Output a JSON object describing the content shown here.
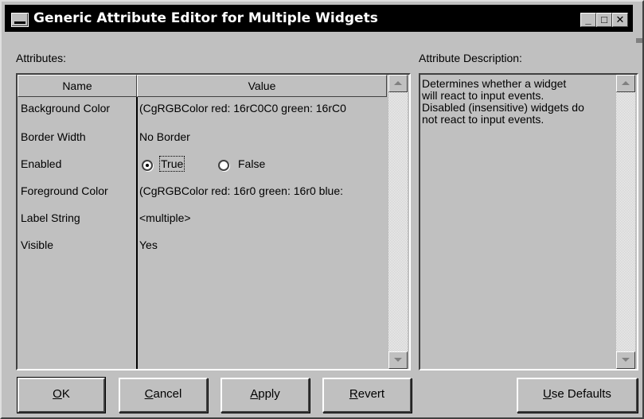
{
  "window": {
    "title": "Generic Attribute Editor for Multiple Widgets",
    "minimize_glyph": "_",
    "maximize_glyph": "□",
    "close_glyph": "✕"
  },
  "attributes_label": "Attributes:",
  "description_label": "Attribute Description:",
  "table": {
    "headers": [
      "Name",
      "Value"
    ],
    "rows": [
      {
        "name": "Background Color",
        "value": "(CgRGBColor red: 16rC0C0 green: 16rC0"
      },
      {
        "name": "Border Width",
        "value": "No Border"
      },
      {
        "name": "Enabled",
        "value": ""
      },
      {
        "name": "Foreground Color",
        "value": "(CgRGBColor red: 16r0 green: 16r0 blue:"
      },
      {
        "name": "Label String",
        "value": "<multiple>"
      },
      {
        "name": "Visible",
        "value": "Yes"
      }
    ],
    "enabled_options": [
      {
        "label": "True",
        "checked": true
      },
      {
        "label": "False",
        "checked": false
      }
    ]
  },
  "description_text": "Determines whether a widget\nwill react to input events.\nDisabled (insensitive) widgets do\nnot react to input events.",
  "buttons": {
    "ok": {
      "mnemonic": "O",
      "rest": "K"
    },
    "cancel": {
      "mnemonic": "C",
      "rest": "ancel"
    },
    "apply": {
      "mnemonic": "A",
      "rest": "pply"
    },
    "revert": {
      "mnemonic": "R",
      "rest": "evert"
    },
    "use_defaults": {
      "mnemonic": "U",
      "rest": "se Defaults"
    }
  },
  "colors": {
    "face": "#c0c0c0",
    "titlebar": "#000000",
    "highlight": "#ffffff",
    "shadow": "#404040"
  }
}
